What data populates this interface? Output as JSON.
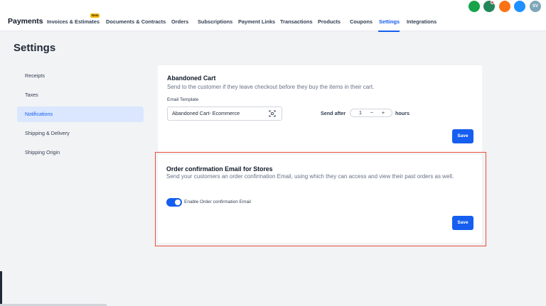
{
  "app": {
    "title": "Payments"
  },
  "nav": {
    "tabs": [
      {
        "label": "Invoices & Estimates"
      },
      {
        "label": "Documents & Contracts"
      },
      {
        "label": "Orders"
      },
      {
        "label": "Subscriptions"
      },
      {
        "label": "Payment Links"
      },
      {
        "label": "Transactions"
      },
      {
        "label": "Products"
      },
      {
        "label": "Coupons"
      },
      {
        "label": "Settings"
      },
      {
        "label": "Integrations"
      }
    ],
    "active_tab": "Settings",
    "new_badge": "New"
  },
  "header": {
    "avatars": [
      {
        "color": "#16a34a"
      },
      {
        "color": "#22875a"
      },
      {
        "color": "#f97316"
      },
      {
        "color": "#1e90ff"
      },
      {
        "color": "#7da6b8",
        "initials": "SV"
      }
    ]
  },
  "page": {
    "title": "Settings"
  },
  "sidebar": {
    "items": [
      {
        "label": "Receipts"
      },
      {
        "label": "Taxes"
      },
      {
        "label": "Notifications"
      },
      {
        "label": "Shipping & Delivery"
      },
      {
        "label": "Shipping Origin"
      }
    ],
    "active": "Notifications"
  },
  "abandoned_cart": {
    "title": "Abandoned Cart",
    "description": "Send to the customer if they leave checkout before they buy the items in their cart.",
    "template_label": "Email Template",
    "template_value": "Abandoned Cart- Ecommerce",
    "send_after_label": "Send after",
    "send_after_value": "1",
    "minus": "−",
    "plus": "+",
    "unit": "hours",
    "save_label": "Save"
  },
  "order_confirmation": {
    "title": "Order confirmation Email for Stores",
    "description": "Send your customers an order confirmation Email, using which they can access and view their past orders as well.",
    "toggle_label": "Enable Order confirmation Email",
    "toggle_on": true,
    "save_label": "Save"
  },
  "colors": {
    "accent": "#155eef",
    "highlight": "#e8503a"
  }
}
